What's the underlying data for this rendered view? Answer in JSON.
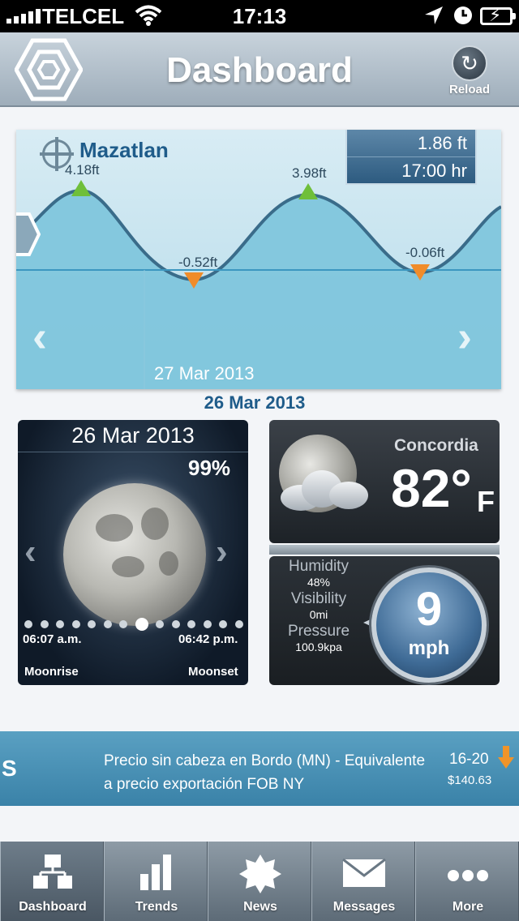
{
  "status_bar": {
    "carrier": "TELCEL",
    "time": "17:13"
  },
  "header": {
    "title": "Dashboard",
    "reload_label": "Reload"
  },
  "tide": {
    "city": "Mazatlan",
    "readout_height": "1.86 ft",
    "readout_time": "17:00 hr",
    "labels": {
      "high1": "4.18ft",
      "low1": "-0.52ft",
      "high2": "3.98ft",
      "low2": "-0.06ft"
    },
    "next_date": "27 Mar 2013",
    "current_date": "26 Mar 2013"
  },
  "moon": {
    "date": "26 Mar 2013",
    "illumination": "99%",
    "moonrise_time": "06:07 a.m.",
    "moonset_time": "06:42 p.m.",
    "moonrise_label": "Moonrise",
    "moonset_label": "Moonset"
  },
  "weather": {
    "city": "Concordia",
    "temperature": "82°",
    "unit": "F",
    "humidity_label": "Humidity",
    "humidity": "48%",
    "visibility_label": "Visibility",
    "visibility": "0mi",
    "pressure_label": "Pressure",
    "pressure": "100.9kpa",
    "wind_speed": "9",
    "wind_unit": "mph"
  },
  "ticker": {
    "lead": "S",
    "message": "Precio sin cabeza en Bordo (MN) - Equivalente a precio exportación FOB NY",
    "range": "16-20",
    "price": "$140.63",
    "trend_color": "#f0942a"
  },
  "tabs": [
    {
      "label": "Dashboard",
      "icon": "dashboard-icon",
      "active": true
    },
    {
      "label": "Trends",
      "icon": "trends-icon",
      "active": false
    },
    {
      "label": "News",
      "icon": "news-icon",
      "active": false
    },
    {
      "label": "Messages",
      "icon": "messages-icon",
      "active": false
    },
    {
      "label": "More",
      "icon": "more-icon",
      "active": false
    }
  ],
  "colors": {
    "accent": "#1f5c8a",
    "ticker_bg": "#4a92b8",
    "tide_high_marker": "#6fbf3a",
    "tide_low_marker": "#f08c2a"
  }
}
